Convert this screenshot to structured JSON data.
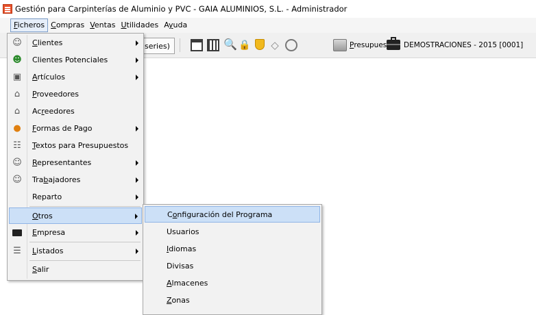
{
  "window": {
    "title": "Gestión para Carpinterías de Aluminio y PVC - GAIA ALUMINIOS, S.L. - Administrador"
  },
  "menubar": {
    "items": [
      {
        "pre": "",
        "acc": "F",
        "post": "icheros"
      },
      {
        "pre": "",
        "acc": "C",
        "post": "ompras"
      },
      {
        "pre": "",
        "acc": "V",
        "post": "entas"
      },
      {
        "pre": "",
        "acc": "U",
        "post": "tilidades"
      },
      {
        "pre": "A",
        "acc": "y",
        "post": "uda"
      }
    ]
  },
  "toolbar": {
    "series_label": "series)",
    "presupuestos_pre": "",
    "presupuestos_acc": "P",
    "presupuestos_post": "resupuestos",
    "company": "DEMOSTRACIONES - 2015 [0001]"
  },
  "ficheros_menu": {
    "items": [
      {
        "pre": "",
        "acc": "C",
        "post": "lientes",
        "icon": "person-icon",
        "submenu": true
      },
      {
        "pre": "Clientes Potenciales",
        "acc": "",
        "post": "",
        "icon": "green-person-icon",
        "submenu": true
      },
      {
        "pre": "",
        "acc": "A",
        "post": "rtículos",
        "icon": "cube-icon",
        "submenu": true
      },
      {
        "pre": "",
        "acc": "P",
        "post": "roveedores",
        "icon": "truck-icon",
        "submenu": false
      },
      {
        "pre": "Ac",
        "acc": "r",
        "post": "eedores",
        "icon": "creditor-icon",
        "submenu": false
      },
      {
        "pre": "",
        "acc": "F",
        "post": "ormas de Pago",
        "icon": "coin-icon",
        "submenu": true
      },
      {
        "pre": "",
        "acc": "T",
        "post": "extos para Presupuestos",
        "icon": "texts-icon",
        "submenu": false
      },
      {
        "pre": "",
        "acc": "R",
        "post": "epresentantes",
        "icon": "agent-icon",
        "submenu": true
      },
      {
        "pre": "Tra",
        "acc": "b",
        "post": "ajadores",
        "icon": "worker-icon",
        "submenu": true
      },
      {
        "pre": "Reparto",
        "acc": "",
        "post": "",
        "icon": "",
        "submenu": true
      },
      {
        "pre": "",
        "acc": "O",
        "post": "tros",
        "icon": "",
        "submenu": true
      },
      {
        "pre": "",
        "acc": "E",
        "post": "mpresa",
        "icon": "briefcase-icon",
        "submenu": true
      },
      {
        "pre": "",
        "acc": "L",
        "post": "istados",
        "icon": "report-icon",
        "submenu": true
      },
      {
        "pre": "",
        "acc": "S",
        "post": "alir",
        "icon": "",
        "submenu": false
      }
    ]
  },
  "otros_submenu": {
    "items": [
      {
        "pre": "C",
        "acc": "o",
        "post": "nfiguración del Programa"
      },
      {
        "pre": "Usuarios",
        "acc": "",
        "post": ""
      },
      {
        "pre": "",
        "acc": "I",
        "post": "diomas"
      },
      {
        "pre": "Divisas",
        "acc": "",
        "post": ""
      },
      {
        "pre": "",
        "acc": "A",
        "post": "lmacenes"
      },
      {
        "pre": "",
        "acc": "Z",
        "post": "onas"
      }
    ]
  }
}
